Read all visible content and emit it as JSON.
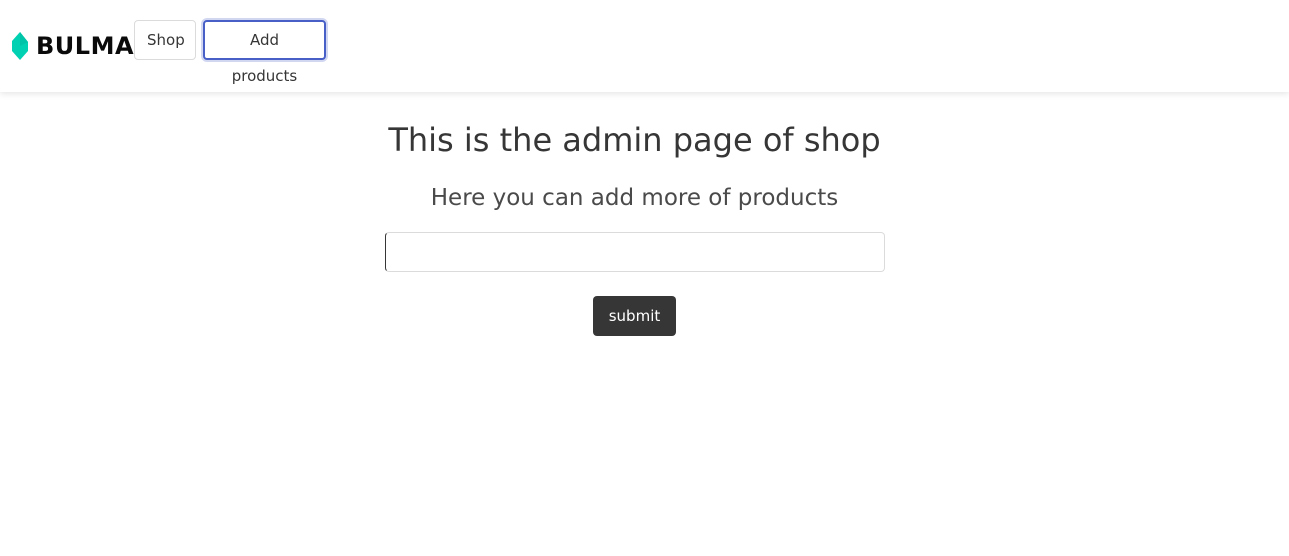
{
  "navbar": {
    "brand_text": "BULMA",
    "brand_icon": "bulma-logo-icon",
    "brand_color": "#00d1b2",
    "items": [
      {
        "label": "Shop"
      },
      {
        "label": "Add products",
        "focused": true
      }
    ]
  },
  "main": {
    "title": "This is the admin page of shop",
    "subtitle": "Here you can add more of products",
    "product_input": {
      "value": "",
      "placeholder": ""
    },
    "submit_label": "submit"
  },
  "colors": {
    "focus_ring": "#485fc7",
    "button_dark": "#363636",
    "text": "#4a4a4a"
  }
}
